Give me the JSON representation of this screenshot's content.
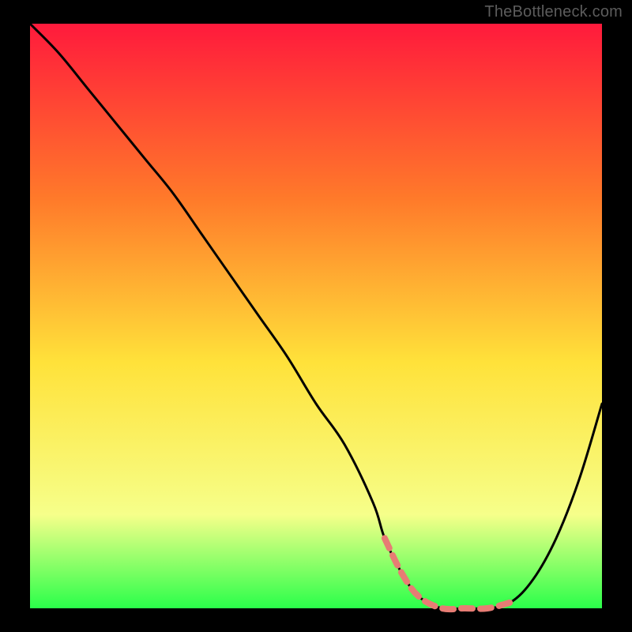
{
  "watermark": "TheBottleneck.com",
  "colors": {
    "background": "#000000",
    "gradient_top": "#ff1a3c",
    "gradient_mid1": "#ff7a2a",
    "gradient_mid2": "#ffe23a",
    "gradient_mid3": "#f6ff8a",
    "gradient_bottom": "#2aff4a",
    "curve_stroke": "#000000",
    "highlight_stroke": "#e77c74"
  },
  "chart_data": {
    "type": "line",
    "title": "",
    "xlabel": "",
    "ylabel": "",
    "xlim": [
      0,
      100
    ],
    "ylim": [
      0,
      100
    ],
    "series": [
      {
        "name": "bottleneck-curve",
        "x": [
          0,
          5,
          10,
          15,
          20,
          25,
          30,
          35,
          40,
          45,
          50,
          55,
          60,
          62,
          65,
          68,
          72,
          76,
          80,
          84,
          88,
          92,
          96,
          100
        ],
        "y": [
          100,
          95,
          89,
          83,
          77,
          71,
          64,
          57,
          50,
          43,
          35,
          28,
          18,
          12,
          6,
          2,
          0,
          0,
          0,
          1,
          5,
          12,
          22,
          35
        ]
      },
      {
        "name": "optimal-zone-highlight",
        "x": [
          62,
          65,
          68,
          72,
          76,
          80,
          84
        ],
        "y": [
          12,
          6,
          2,
          0,
          0,
          0,
          1
        ]
      }
    ],
    "optimal_range_x": [
      62,
      84
    ]
  }
}
